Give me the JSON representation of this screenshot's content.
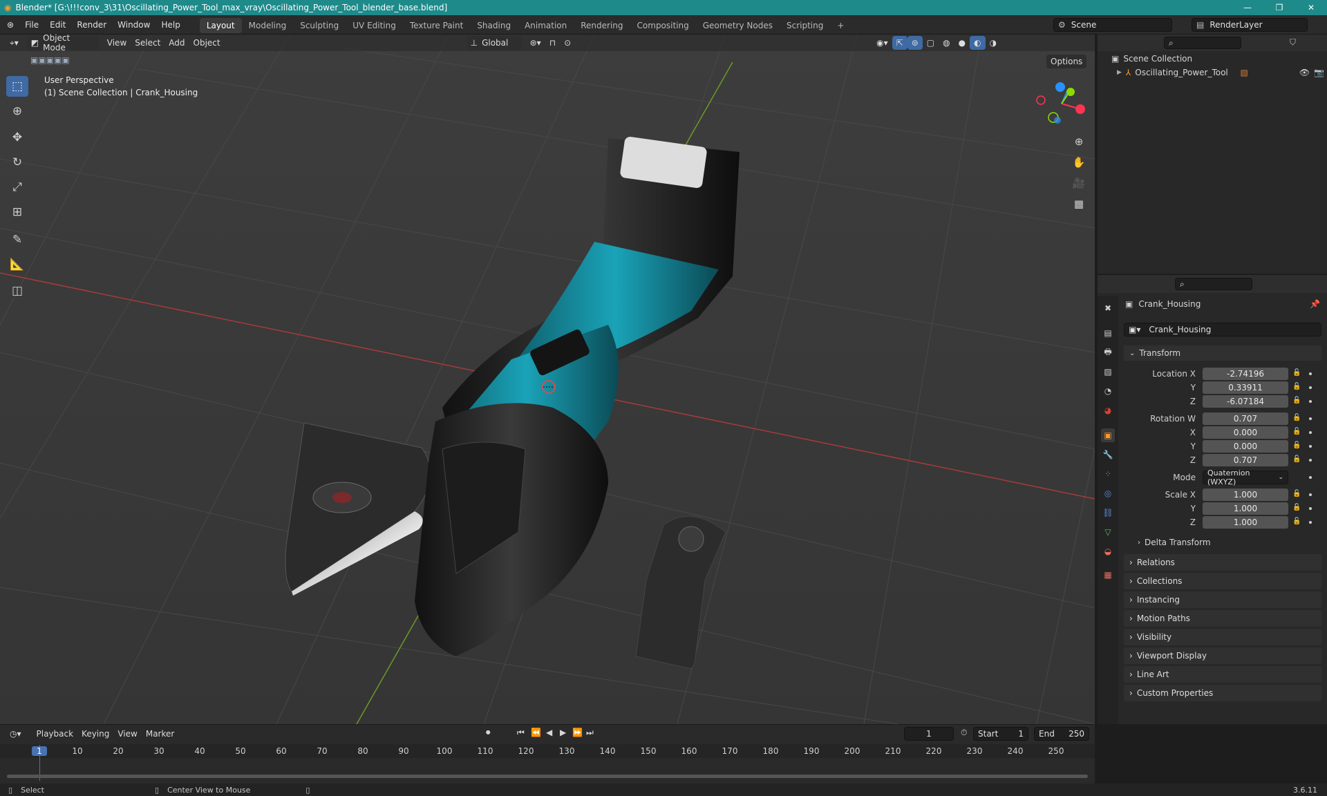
{
  "window": {
    "title": "Blender* [G:\\!!!conv_3\\31\\Oscillating_Power_Tool_max_vray\\Oscillating_Power_Tool_blender_base.blend]"
  },
  "menu": {
    "items": [
      "File",
      "Edit",
      "Render",
      "Window",
      "Help"
    ]
  },
  "workspaces": [
    "Layout",
    "Modeling",
    "Sculpting",
    "UV Editing",
    "Texture Paint",
    "Shading",
    "Animation",
    "Rendering",
    "Compositing",
    "Geometry Nodes",
    "Scripting"
  ],
  "active_workspace": "Layout",
  "scene": {
    "name": "Scene",
    "render_layer": "RenderLayer"
  },
  "viewport": {
    "mode": "Object Mode",
    "menus": [
      "View",
      "Select",
      "Add",
      "Object"
    ],
    "orientation": "Global",
    "options_label": "Options",
    "perspective_label": "User Perspective",
    "collection_label": "(1) Scene Collection | Crank_Housing",
    "gizmo": {
      "x": "X",
      "y": "Y",
      "z": "Z"
    }
  },
  "outliner": {
    "root": "Scene Collection",
    "items": [
      {
        "name": "Oscillating_Power_Tool"
      }
    ]
  },
  "properties": {
    "object_name": "Crank_Housing",
    "data_name": "Crank_Housing",
    "section": "Transform",
    "location": {
      "label": "Location X",
      "x": "-2.74196",
      "y": "0.33911",
      "z": "-6.07184"
    },
    "rotation": {
      "label": "Rotation W",
      "w": "0.707",
      "x": "0.000",
      "y": "0.000",
      "z": "0.707"
    },
    "mode_label": "Mode",
    "mode": "Quaternion (WXYZ)",
    "scale": {
      "label": "Scale X",
      "x": "1.000",
      "y": "1.000",
      "z": "1.000"
    },
    "axis_labels": {
      "y": "Y",
      "z": "Z",
      "x": "X"
    },
    "subpanels": [
      "Delta Transform"
    ],
    "panels": [
      "Relations",
      "Collections",
      "Instancing",
      "Motion Paths",
      "Visibility",
      "Viewport Display",
      "Line Art",
      "Custom Properties"
    ]
  },
  "timeline": {
    "menus": [
      "Playback",
      "Keying",
      "View",
      "Marker"
    ],
    "current_frame": "1",
    "start_label": "Start",
    "start": "1",
    "end_label": "End",
    "end": "250",
    "ticks": [
      "1",
      "10",
      "20",
      "30",
      "40",
      "50",
      "60",
      "70",
      "80",
      "90",
      "100",
      "110",
      "120",
      "130",
      "140",
      "150",
      "160",
      "170",
      "180",
      "190",
      "200",
      "210",
      "220",
      "230",
      "240",
      "250"
    ]
  },
  "status": {
    "select": "Select",
    "center": "Center View to Mouse",
    "version": "3.6.11"
  },
  "colors": {
    "titlebar": "#1f8a8a",
    "accent": "#3f6aa3",
    "axis_x": "#ff3352",
    "axis_y": "#8bdc00",
    "axis_z": "#2890ff"
  }
}
